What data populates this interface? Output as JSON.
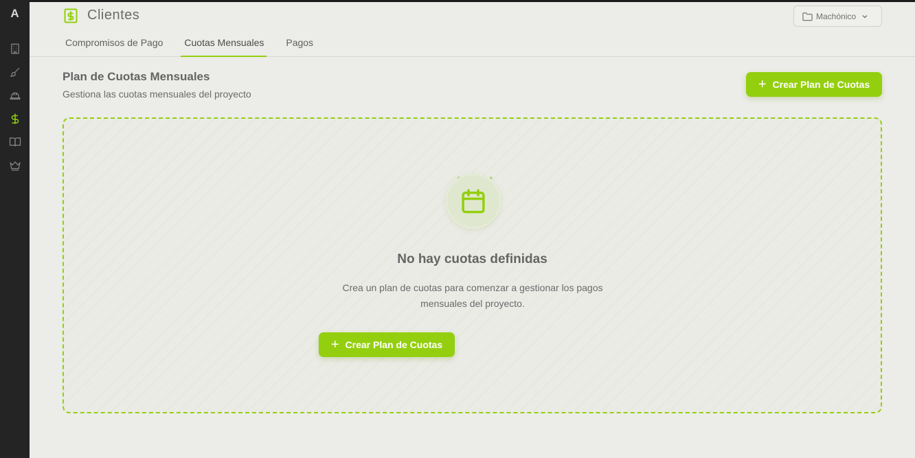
{
  "sidebar": {
    "logo": "A",
    "items": [
      {
        "name": "sidebar-item-buildings",
        "icon": "building-icon",
        "active": false
      },
      {
        "name": "sidebar-item-design",
        "icon": "brush-icon",
        "active": false
      },
      {
        "name": "sidebar-item-construction",
        "icon": "hardhat-icon",
        "active": false
      },
      {
        "name": "sidebar-item-clients",
        "icon": "dollar-icon",
        "active": true
      },
      {
        "name": "sidebar-item-library",
        "icon": "book-icon",
        "active": false
      },
      {
        "name": "sidebar-item-premium",
        "icon": "crown-icon",
        "active": false
      }
    ]
  },
  "header": {
    "title": "Clientes",
    "title_icon": "dollar-square-icon",
    "project": "Machónico"
  },
  "tabs": [
    {
      "label": "Compromisos de Pago",
      "active": false
    },
    {
      "label": "Cuotas Mensuales",
      "active": true
    },
    {
      "label": "Pagos",
      "active": false
    }
  ],
  "section": {
    "title": "Plan de Cuotas Mensuales",
    "subtitle": "Gestiona las cuotas mensuales del proyecto",
    "create_button": "Crear Plan de Cuotas"
  },
  "empty_state": {
    "icon": "calendar-icon",
    "title": "No hay cuotas definidas",
    "description": "Crea un plan de cuotas para comenzar a gestionar los pagos mensuales del proyecto.",
    "button": "Crear Plan de Cuotas"
  },
  "colors": {
    "accent": "#93cf0e",
    "sidebar_bg": "#242424",
    "page_bg": "#ecece8"
  }
}
